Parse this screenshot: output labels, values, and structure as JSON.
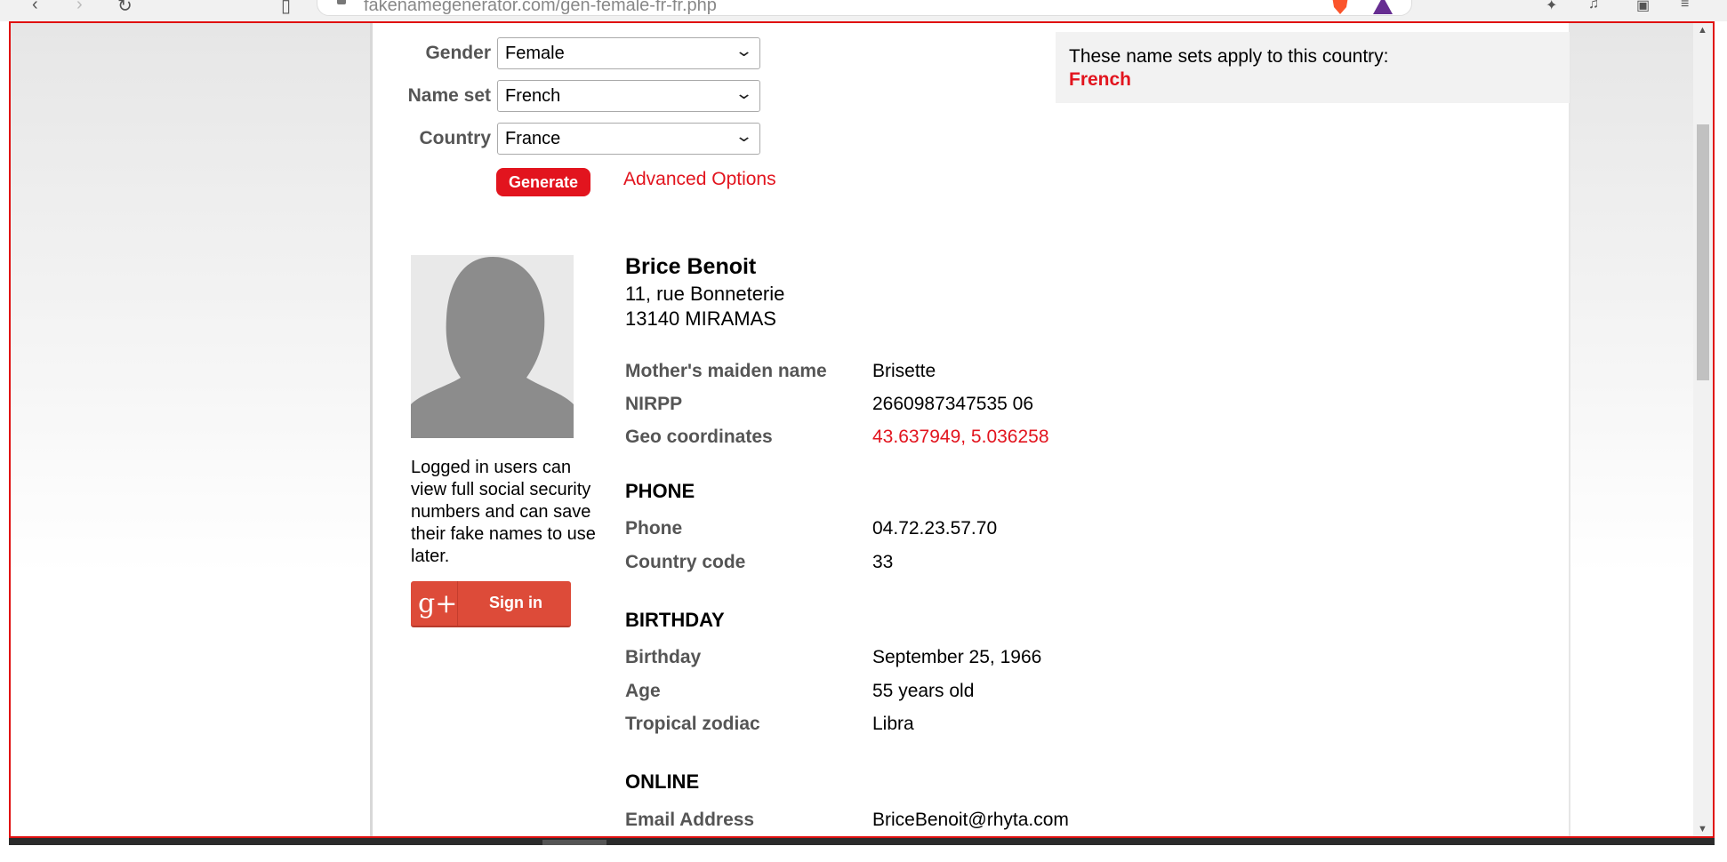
{
  "browser": {
    "url": "fakenamegenerator.com/gen-female-fr-fr.php"
  },
  "form": {
    "gender_label": "Gender",
    "gender_value": "Female",
    "nameset_label": "Name set",
    "nameset_value": "French",
    "country_label": "Country",
    "country_value": "France",
    "generate_label": "Generate",
    "advanced_label": "Advanced Options"
  },
  "namesets": {
    "text": "These name sets apply to this country:",
    "value": "French"
  },
  "sidebar": {
    "login_text": "Logged in users can view full social security numbers and can save their fake names to use later.",
    "signin_icon": "g+",
    "signin_label": "Sign in"
  },
  "person": {
    "name": "Brice Benoit",
    "address_line1": "11, rue Bonneterie",
    "address_line2": "13140 MIRAMAS"
  },
  "details": [
    {
      "label": "Mother's maiden name",
      "value": "Brisette"
    },
    {
      "label": "NIRPP",
      "value": "2660987347535 06"
    },
    {
      "label": "Geo coordinates",
      "value": "43.637949, 5.036258"
    }
  ],
  "phone": {
    "heading": "PHONE",
    "rows": [
      {
        "label": "Phone",
        "value": "04.72.23.57.70"
      },
      {
        "label": "Country code",
        "value": "33"
      }
    ]
  },
  "birthday": {
    "heading": "BIRTHDAY",
    "rows": [
      {
        "label": "Birthday",
        "value": "September 25, 1966"
      },
      {
        "label": "Age",
        "value": "55 years old"
      },
      {
        "label": "Tropical zodiac",
        "value": "Libra"
      }
    ]
  },
  "online": {
    "heading": "ONLINE",
    "rows": [
      {
        "label": "Email Address",
        "value": "BriceBenoit@rhyta.com"
      }
    ]
  },
  "colors": {
    "accent": "#e2141e",
    "frame": "#e01010",
    "google": "#dd4b39"
  }
}
